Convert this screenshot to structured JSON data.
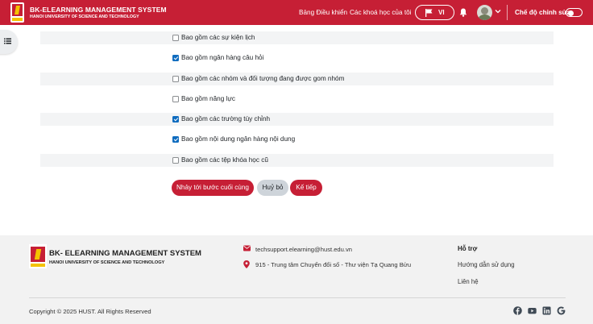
{
  "header": {
    "brand_title": "BK-ELEARNING MANAGEMENT SYSTEM",
    "brand_subtitle": "HANOI UNIVERSITY OF SCIENCE AND TECHNOLOGY",
    "nav": [
      "Bảng Điều khiển",
      "Các khoá học của tôi"
    ],
    "language": "VI",
    "edit_mode_label": "Chế độ chỉnh sửa",
    "edit_mode_on": false,
    "accent_color": "#c61f35"
  },
  "options": [
    {
      "label": "Bao gồm các sự kiện lịch",
      "checked": false
    },
    {
      "label": "Bao gồm ngân hàng câu hỏi",
      "checked": true
    },
    {
      "label": "Bao gồm các nhóm và đối tượng đang được gom nhóm",
      "checked": false
    },
    {
      "label": "Bao gồm năng lực",
      "checked": false
    },
    {
      "label": "Bao gồm các trường tùy chỉnh",
      "checked": true
    },
    {
      "label": "Bao gồm nội dung ngân hàng nội dung",
      "checked": true
    },
    {
      "label": "Bao gồm các tệp khóa học cũ",
      "checked": false
    }
  ],
  "buttons": {
    "jump_to_final": "Nhảy tới bước cuối cùng",
    "cancel": "Huỷ bỏ",
    "next": "Kế tiếp"
  },
  "footer": {
    "brand_title": "BK- ELEARNING MANAGEMENT SYSTEM",
    "brand_subtitle": "HANOI UNIVERSITY OF SCIENCE AND TECHNOLOGY",
    "email": "techsupport.elearning@hust.edu.vn",
    "address": "915 - Trung tâm Chuyển đổi số - Thư viện Tạ Quang Bửu",
    "support_title": "Hỗ trợ",
    "support_links": [
      "Hướng dẫn sử dụng",
      "Liên hệ"
    ],
    "copyright": "Copyright © 2025 HUST. All Rights Reserved",
    "social_icons": [
      "facebook-icon",
      "youtube-icon",
      "linkedin-icon",
      "google-icon"
    ]
  }
}
